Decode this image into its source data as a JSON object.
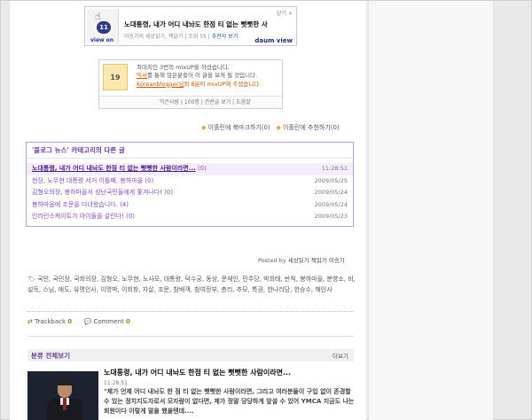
{
  "viewon": {
    "close_label": "닫기 ×",
    "count": "11",
    "view_label": "view on",
    "title": "노대통령, 내가 어디 내놔도 한점 티 없는 뻣뻣한 사",
    "meta": "이승기의 세상읽기, 책읽기 | 조회 55 |",
    "recommend_label": "추천자 보기",
    "logo_text": "daum view"
  },
  "mixup": {
    "number": "19",
    "line1": "최대치인 3번의 mixUP을 하셨습니다.",
    "line2_link": "믹서",
    "line2_rest": "를 통해 많은분들이 이 글을 보게 될 것입니다.",
    "line3_link": "Koreanblogger님",
    "line3_rest": "외 8분이 mixUP해 주셨습니다.",
    "footer": "믹은사람 | 100명 | 관련글 보기 | 도움말"
  },
  "bookmark": {
    "bookmark_label": "이홀린에 북마크하기",
    "bookmark_count": "(0)",
    "recommend_label": "이홀린에 추천하기",
    "recommend_count": "(0)"
  },
  "other_posts": {
    "header": "'블로그 뉴스' 카테고리의 다른 글",
    "items": [
      {
        "title": "노대통령, 내가 어디 내놔도 한점 티 없는 뻣뻣한 사람이라면...",
        "count": "(0)",
        "date": "11:28:51"
      },
      {
        "title": "현장, 노무현 대통령 서거 이틀째, 봉하마을",
        "count": "(0)",
        "date": "2009/05/25"
      },
      {
        "title": "김형오의장, 봉하마을서 성난국민들에게 쫓겨나다!",
        "count": "(0)",
        "date": "2009/05/24"
      },
      {
        "title": "봉하마을에 조문을 다녀왔습니다.",
        "count": "(4)",
        "date": "2009/05/24"
      },
      {
        "title": "인라인스케이트가 아이들을 살린다!",
        "count": "(0)",
        "date": "2009/05/23"
      }
    ]
  },
  "posted_by": {
    "prefix": "Posted by",
    "author": "세상읽기 책읽기 이승기"
  },
  "tags": {
    "text": "국민, 국민장, 국회의장, 김형오, 노무현, 노사모, 대통령, 덕수궁, 동상, 문재인, 민주당, 박희태, 반칙, 봉하마을, 분향소, 비, 설득, 스님, 애도, 유명인사, 이명박, 이회창, 자살, 조문, 참배객, 참여정부, 총리, 추모, 특권, 한나라당, 한승수, 해인사"
  },
  "feedback": {
    "trackback_label": "Trackback",
    "trackback_count": "0",
    "comment_label": "Comment",
    "comment_count": "0"
  },
  "category": {
    "title": "분류 전체보기",
    "more": "더보기"
  },
  "recent_post": {
    "title": "노대통령, 내가 어디 내놔도 한점 티 없는 뻣뻣한 사람이라면...",
    "time": "11:28:51",
    "excerpt": "\"제가 언제 어디 내놔도 한 점 티 없는 뻣뻣한 사람이라면, 그리고 여러분들이 구입 없이 존경할 수 있는 정치지도자로서 모자람이 없다면, 제가 정말 당당하게 앞설 수 있어 YMCA 지금도 나는 회원이다 이렇게 말을 했을텐데...."
  }
}
